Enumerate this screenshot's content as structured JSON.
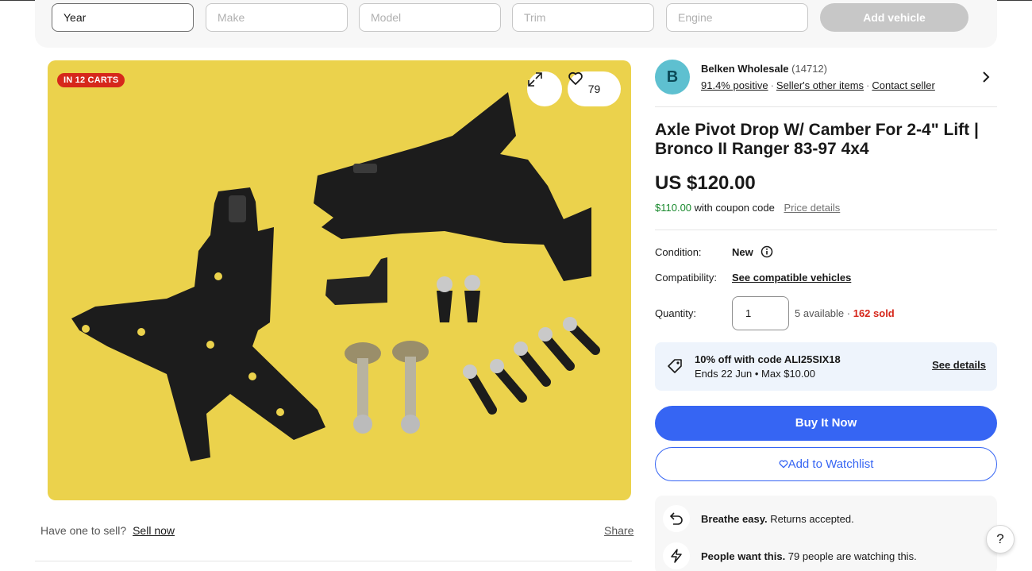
{
  "vehicle": {
    "year": "Year",
    "make": "Make",
    "model": "Model",
    "trim": "Trim",
    "engine": "Engine",
    "add_label": "Add vehicle"
  },
  "image": {
    "carts_badge": "IN 12 CARTS",
    "watch_count": "79"
  },
  "sell": {
    "prompt": "Have one to sell?",
    "link": "Sell now",
    "share": "Share"
  },
  "seller": {
    "initial": "B",
    "name": "Belken Wholesale",
    "count": "(14712)",
    "positive": "91.4% positive",
    "other_items": "Seller's other items",
    "contact": "Contact seller",
    "sep": "·"
  },
  "listing": {
    "title": "Axle Pivot Drop W/ Camber For 2-4\" Lift | Bronco II Ranger 83-97 4x4",
    "price": "US $120.00",
    "coupon_price": "$110.00",
    "coupon_text": "with coupon code",
    "price_details": "Price details",
    "condition_label": "Condition:",
    "condition_value": "New",
    "compat_label": "Compatibility:",
    "compat_link": "See compatible vehicles",
    "quantity_label": "Quantity:",
    "quantity_value": "1",
    "available": "5 available",
    "dot": " · ",
    "sold": "162 sold"
  },
  "promo": {
    "title": "10% off with code ALI25SIX18",
    "subtitle": "Ends 22 Jun • Max $10.00",
    "see_details": "See details"
  },
  "actions": {
    "buy": "Buy It Now",
    "watchlist": "Add to Watchlist"
  },
  "assurances": [
    {
      "bold": "Breathe easy.",
      "text": " Returns accepted."
    },
    {
      "bold": "People want this.",
      "text": " 79 people are watching this."
    }
  ],
  "help": "?",
  "colors": {
    "primary": "#3665f3",
    "badge": "#d6271b",
    "coupon_green": "#1a8a2e",
    "image_bg": "#ebd24c",
    "promo_bg": "#eef4fc"
  }
}
